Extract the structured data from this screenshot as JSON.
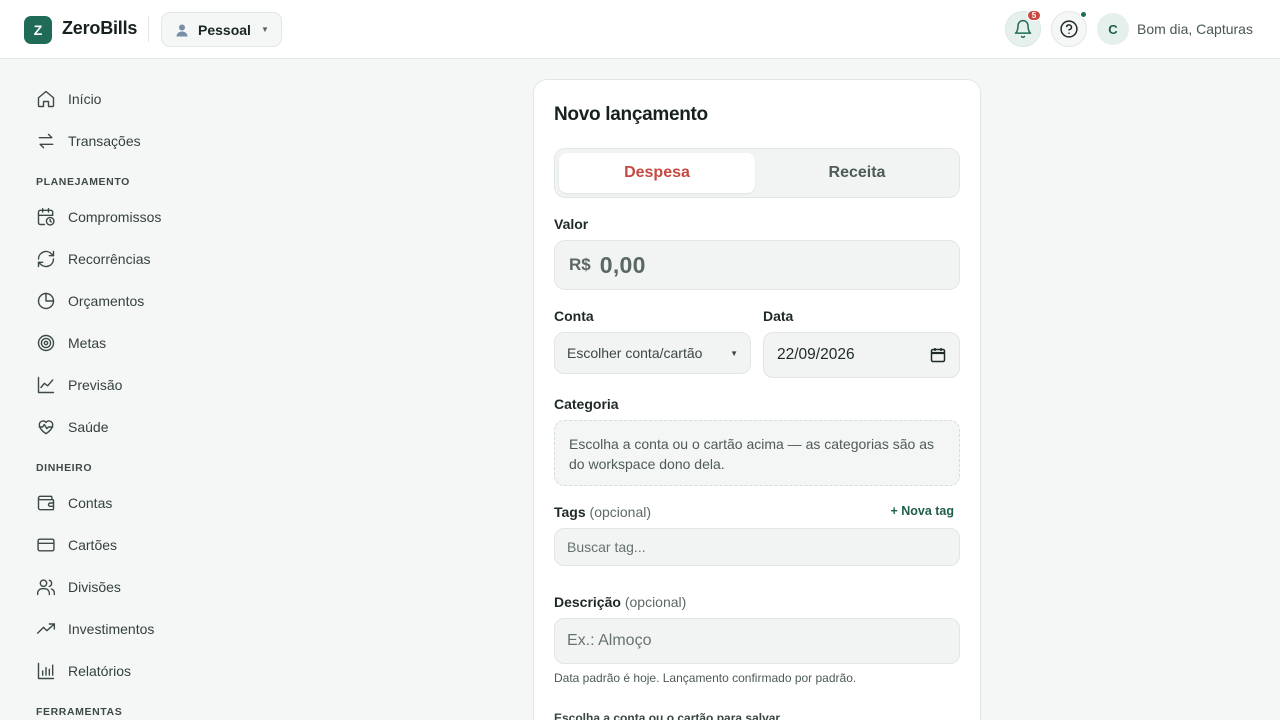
{
  "app": {
    "logo_letter": "Z",
    "name": "ZeroBills"
  },
  "workspace": {
    "label": "Pessoal"
  },
  "notifications": {
    "count": "5"
  },
  "user": {
    "initial": "C",
    "greeting": "Bom dia, Capturas"
  },
  "sidebar": {
    "items_top": [
      {
        "label": "Início",
        "icon": "home-icon"
      },
      {
        "label": "Transações",
        "icon": "arrows-exchange-icon"
      }
    ],
    "sections": [
      {
        "label": "PLANEJAMENTO",
        "items": [
          {
            "label": "Compromissos",
            "icon": "calendar-clock-icon"
          },
          {
            "label": "Recorrências",
            "icon": "refresh-icon"
          },
          {
            "label": "Orçamentos",
            "icon": "pie-chart-icon"
          },
          {
            "label": "Metas",
            "icon": "target-icon"
          },
          {
            "label": "Previsão",
            "icon": "line-chart-icon"
          },
          {
            "label": "Saúde",
            "icon": "heart-pulse-icon"
          }
        ]
      },
      {
        "label": "DINHEIRO",
        "items": [
          {
            "label": "Contas",
            "icon": "wallet-icon"
          },
          {
            "label": "Cartões",
            "icon": "credit-card-icon"
          },
          {
            "label": "Divisões",
            "icon": "users-icon"
          },
          {
            "label": "Investimentos",
            "icon": "trending-up-icon"
          },
          {
            "label": "Relatórios",
            "icon": "bar-chart-icon"
          }
        ]
      },
      {
        "label": "FERRAMENTAS",
        "items": []
      }
    ]
  },
  "form": {
    "title": "Novo lançamento",
    "type_options": [
      "Despesa",
      "Receita"
    ],
    "selected_type": "Despesa",
    "valor": {
      "label": "Valor",
      "currency": "R$",
      "placeholder": "0,00"
    },
    "conta": {
      "label": "Conta",
      "placeholder": "Escolher conta/cartão"
    },
    "data": {
      "label": "Data",
      "value": "22/09/2026"
    },
    "categoria": {
      "label": "Categoria",
      "message": "Escolha a conta ou o cartão acima — as categorias são as do workspace dono dela."
    },
    "tags": {
      "label": "Tags",
      "optional": "(opcional)",
      "new_tag": "+ Nova tag",
      "placeholder": "Buscar tag..."
    },
    "descricao": {
      "label": "Descrição",
      "optional": "(opcional)",
      "placeholder": "Ex.: Almoço"
    },
    "hint": "Data padrão é hoje. Lançamento confirmado por padrão.",
    "footer_hint": "Escolha a conta ou o cartão para salvar."
  },
  "colors": {
    "brand": "#1f6b57",
    "expense": "#c54a42",
    "badge": "#c84a40"
  }
}
